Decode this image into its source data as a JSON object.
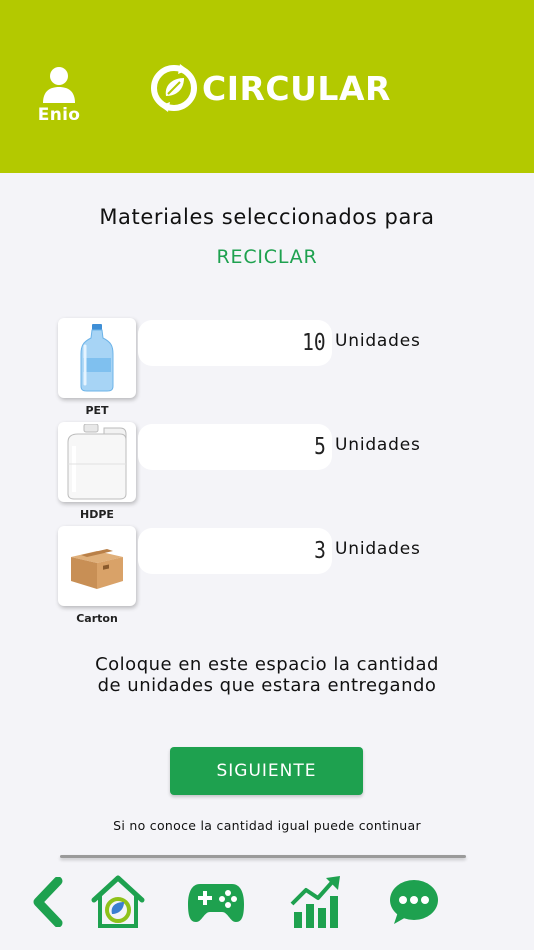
{
  "header": {
    "user_name": "Enio",
    "app_name": "CIRCULAR",
    "bg_color": "#b3c900"
  },
  "main": {
    "title": "Materiales seleccionados para",
    "subtitle": "RECICLAR",
    "materials": [
      {
        "label": "PET",
        "quantity": "10",
        "unit": "Unidades",
        "icon": "plastic-bottle-icon"
      },
      {
        "label": "HDPE",
        "quantity": "5",
        "unit": "Unidades",
        "icon": "jerrycan-icon"
      },
      {
        "label": "Carton",
        "quantity": "3",
        "unit": "Unidades",
        "icon": "cardboard-box-icon"
      }
    ],
    "instruction": "Coloque en este espacio la cantidad de unidades que estara entregando",
    "next_label": "SIGUIENTE",
    "hint": "Si no conoce la cantidad igual puede continuar",
    "accent_color": "#1ea14f"
  },
  "nav": {
    "items": [
      "back-icon",
      "recycle-home-icon",
      "gamepad-icon",
      "chart-icon",
      "chat-icon"
    ]
  }
}
